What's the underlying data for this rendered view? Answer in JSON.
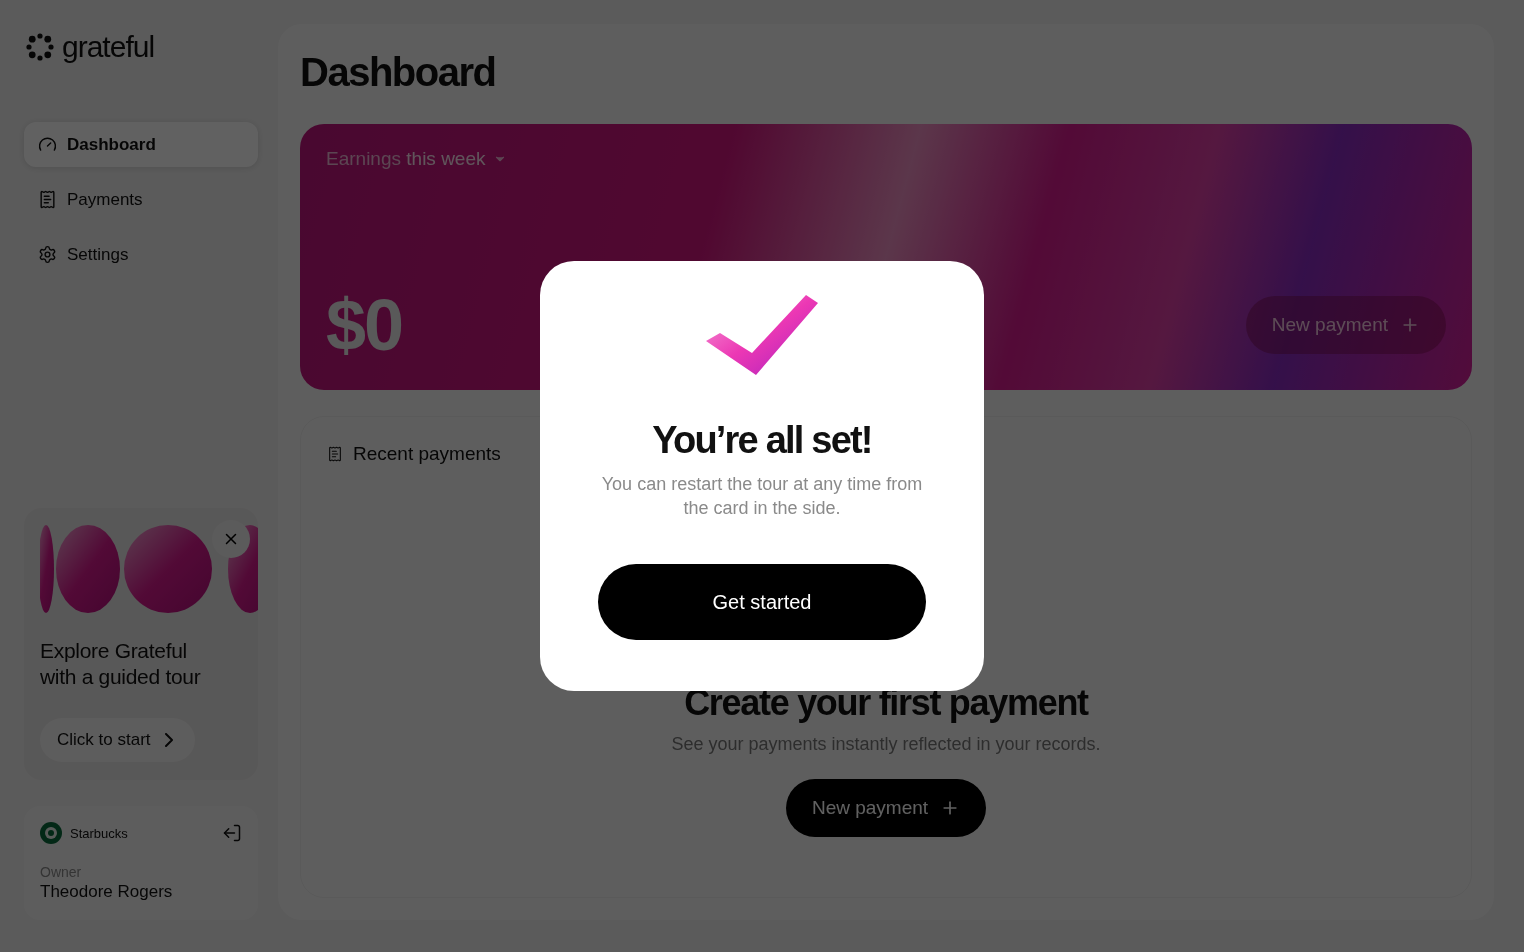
{
  "brand": {
    "name": "grateful"
  },
  "nav": [
    {
      "label": "Dashboard",
      "selected": true
    },
    {
      "label": "Payments",
      "selected": false
    },
    {
      "label": "Settings",
      "selected": false
    }
  ],
  "tour_card": {
    "title": "Explore Grateful with a guided tour",
    "button": "Click to start"
  },
  "account": {
    "business": "Starbucks",
    "role": "Owner",
    "name": "Theodore Rogers"
  },
  "page": {
    "title": "Dashboard"
  },
  "earnings": {
    "label": "Earnings **this week**",
    "amount": "$0",
    "button": "New payment"
  },
  "recent": {
    "title": "Recent payments",
    "empty_title": "Create your first payment",
    "empty_text": "See your payments instantly reflected in your records.",
    "button": "New payment"
  },
  "modal": {
    "title": "You’re all set!",
    "text": "You can restart the tour at any time from the card in the side.",
    "button": "Get started"
  }
}
